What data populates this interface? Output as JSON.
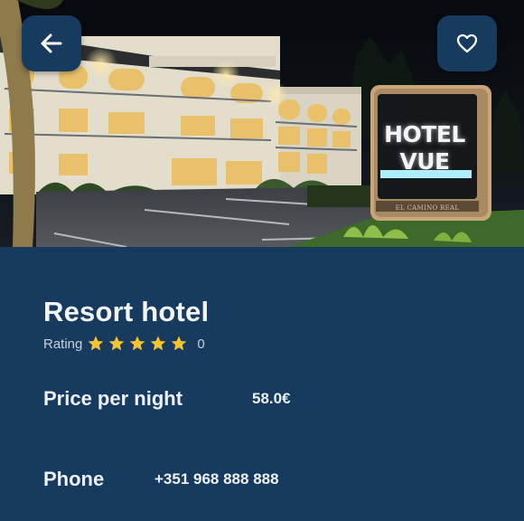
{
  "hotel": {
    "name": "Resort hotel",
    "rating_label": "Rating",
    "stars": 5,
    "rating_count": "0"
  },
  "details": {
    "price_label": "Price per night",
    "price_value": "58.0€",
    "phone_label": "Phone",
    "phone_value": "+351 968 888 888"
  },
  "photo": {
    "sign_line1": "HOTEL",
    "sign_line2": "VUE",
    "sign_address": "EL CAMINO REAL"
  },
  "icons": {
    "back": "arrow-left-icon",
    "favorite": "heart-outline-icon",
    "star": "star-icon"
  },
  "colors": {
    "panel": "#173b5f",
    "star": "#f4c430",
    "text": "#eef1f5"
  }
}
